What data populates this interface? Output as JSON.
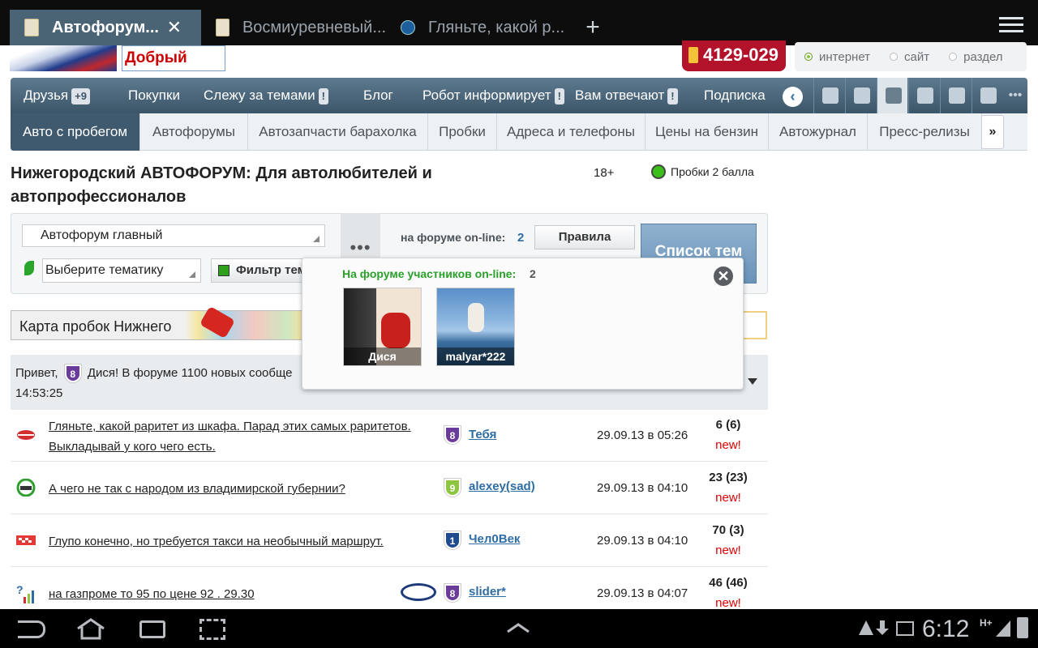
{
  "browser": {
    "tabs": [
      {
        "label": "Автофорум...",
        "active": true,
        "close": "✕"
      },
      {
        "label": "Восмиуревневый...",
        "active": false
      },
      {
        "label": "Гляньте, какой р...",
        "active": false
      }
    ],
    "new_tab": "+"
  },
  "header": {
    "logo_text": "Добрый доктор",
    "phone": "4129-029",
    "search_scope": [
      "интернет",
      "сайт",
      "раздел"
    ],
    "search_scope_selected": "интернет"
  },
  "nav": {
    "items": [
      {
        "label": "Друзья",
        "badge": "+9"
      },
      {
        "label": "Покупки"
      },
      {
        "label": "Слежу за темами",
        "badge": "!"
      },
      {
        "label": "Блог"
      },
      {
        "label": "Робот информирует",
        "badge": "!"
      },
      {
        "label": "Вам отвечают",
        "badge": "!"
      },
      {
        "label": "Подписка"
      }
    ],
    "back": "‹",
    "more": "•••"
  },
  "subnav": {
    "items": [
      "Авто с пробегом",
      "Автофорумы",
      "Автозапчасти барахолка",
      "Пробки",
      "Адреса и телефоны",
      "Цены на бензин",
      "Автожурнал",
      "Пресс-релизы"
    ],
    "active": "Авто с пробегом",
    "next": "»"
  },
  "page": {
    "title": "Нижегородский АВТОФОРУМ: Для автолюбителей и автопрофессионалов",
    "age": "18+",
    "traffic": "Пробки 2 балла"
  },
  "forum": {
    "section": "Автофорум главный",
    "topic_placeholder": "Выберите тематику",
    "filter": "Фильтр тем",
    "dots": "•••",
    "online_label": "на форуме on-line:",
    "online_count": "2",
    "rules": "Правила",
    "list_button": "Список тем"
  },
  "banner": {
    "map": "Карта пробок Нижнего"
  },
  "greeting": {
    "prefix": "Привет,",
    "rank": "8",
    "text": "Дися! В форуме 1100 новых сообще",
    "time": "14:53:25"
  },
  "topics": [
    {
      "title": "Гляньте, какой раритет из шкафа. Парад этих самых раритетов. Выкладывай у кого чего есть.",
      "rank": "8",
      "author": "Тебя",
      "date": "29.09.13 в 05:26",
      "count": "6 (6)",
      "new": "new!"
    },
    {
      "title": "А чего не так с народом из владимирской губернии?",
      "rank": "9",
      "author": "alexey(sad)",
      "date": "29.09.13 в 04:10",
      "count": "23 (23)",
      "new": "new!"
    },
    {
      "title": "Глупо конечно, но требуется такси на необычный маршрут.",
      "rank": "1",
      "author": "Чел0Век",
      "date": "29.09.13 в 04:10",
      "count": "70 (3)",
      "new": "new!"
    },
    {
      "title": "на газпроме то 95 по цене 92 . 29.30",
      "rank": "8",
      "author": "slider*",
      "date": "29.09.13 в 04:07",
      "count": "46 (46)",
      "new": "new!"
    }
  ],
  "popup": {
    "title": "На форуме участников on-line:",
    "count": "2",
    "users": [
      "Дися",
      "malyar*222"
    ],
    "close": "✕"
  },
  "status": {
    "clock": "6:12",
    "network": "H+"
  },
  "colors": {
    "nav": "#3c5568",
    "link": "#2e6da4",
    "new": "#dd0000",
    "online": "#2aa02a",
    "phone": "#b3122b"
  }
}
